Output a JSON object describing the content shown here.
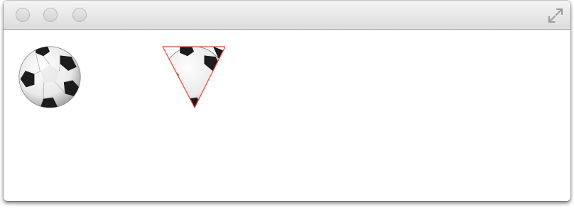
{
  "window": {
    "controls": {
      "close": "close-button",
      "minimize": "minimize-button",
      "zoom": "zoom-button",
      "fullscreen_icon": "fullscreen-icon"
    },
    "colors": {
      "clip_outline": "#ff3b30",
      "titlebar_top": "#f4f4f4",
      "titlebar_bottom": "#dcdcdc"
    }
  },
  "content": {
    "images": [
      {
        "name": "soccer-ball-image",
        "icon": "soccer-ball-icon"
      },
      {
        "name": "soccer-ball-triangle-clipped-image",
        "icon": "soccer-ball-icon",
        "clip": "triangle"
      }
    ]
  }
}
